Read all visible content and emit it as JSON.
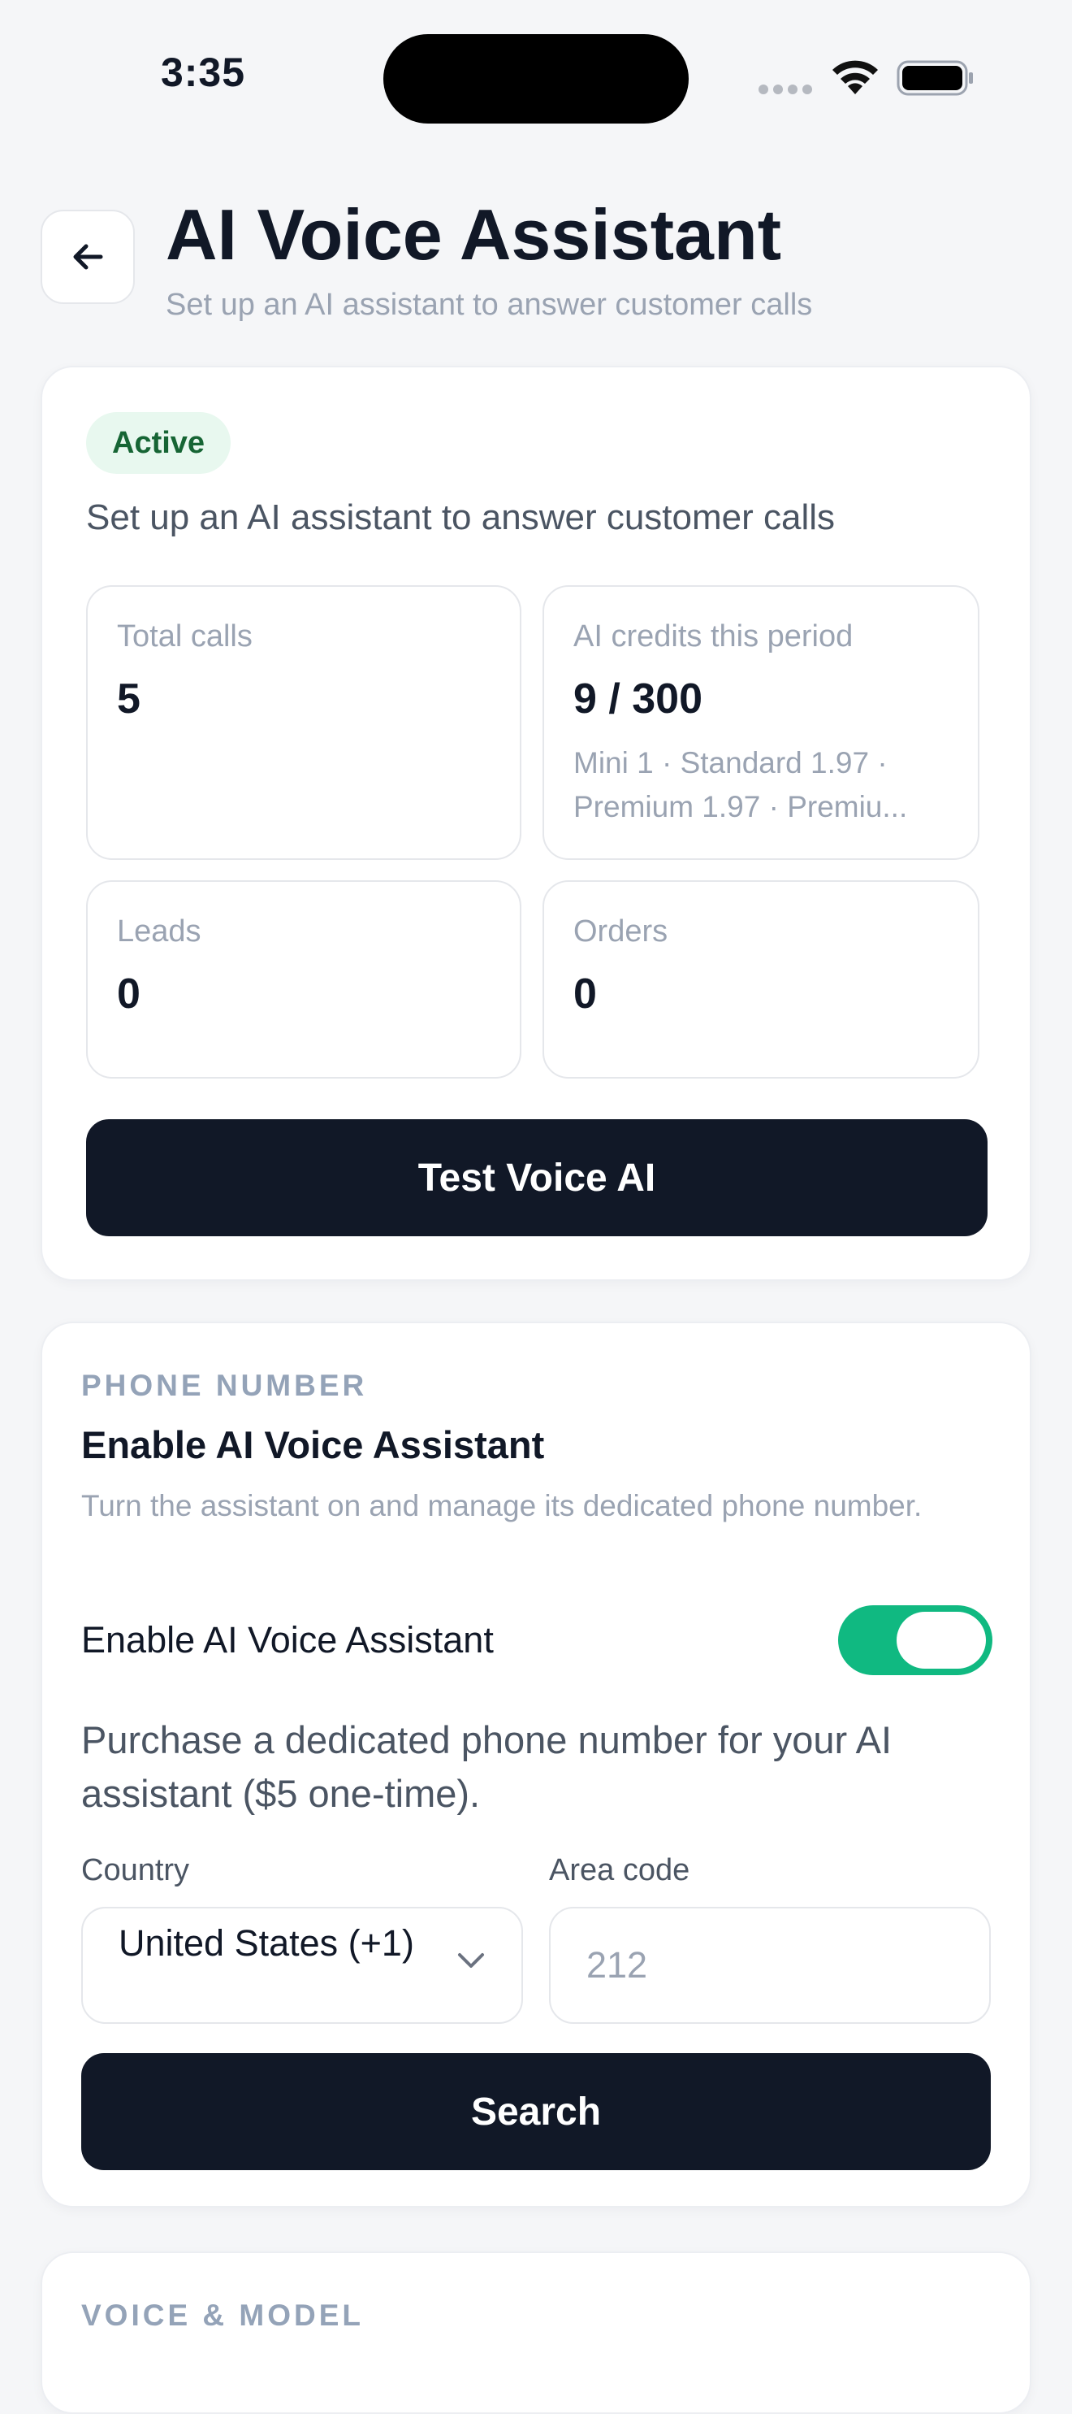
{
  "status_bar": {
    "time": "3:35"
  },
  "header": {
    "title": "AI Voice Assistant",
    "subtitle": "Set up an AI assistant to answer customer calls"
  },
  "overview": {
    "badge": "Active",
    "description": "Set up an AI assistant to answer customer calls",
    "stats": [
      {
        "label": "Total calls",
        "value": "5"
      },
      {
        "label": "AI credits this period",
        "value": "9 / 300",
        "note": "Mini 1 · Standard 1.97 · Premium 1.97 · Premiu..."
      },
      {
        "label": "Leads",
        "value": "0"
      },
      {
        "label": "Orders",
        "value": "0"
      }
    ],
    "test_button": "Test Voice AI"
  },
  "phone_section": {
    "label": "PHONE NUMBER",
    "title": "Enable AI Voice Assistant",
    "description": "Turn the assistant on and manage its dedicated phone number.",
    "toggle_label": "Enable AI Voice Assistant",
    "toggle_on": true,
    "purchase_text": "Purchase a dedicated phone number for your AI assistant ($5 one-time).",
    "country_label": "Country",
    "country_value": "United States (+1)",
    "area_code_label": "Area code",
    "area_code_placeholder": "212",
    "search_button": "Search"
  },
  "voice_section": {
    "label": "VOICE & MODEL"
  },
  "colors": {
    "accent_green": "#10b981",
    "primary_dark": "#111827",
    "badge_bg": "#e8f8ef",
    "badge_text": "#166534"
  }
}
